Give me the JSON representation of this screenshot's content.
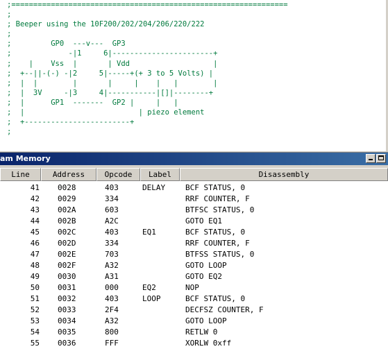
{
  "editor": {
    "lines": [
      ";===============================================================",
      ";",
      "; Beeper using the 10F200/202/204/206/220/222",
      ";",
      ";         GP0  ---v---  GP3",
      ";             -|1     6|-----------------------+",
      ";    |    Vss  |       | Vdd                   |",
      ";  +--||-(-) -|2     5|-----+(+ 3 to 5 Volts) |",
      ";  |  |        |       |     |    |   |        |",
      ";  |  3V     -|3     4|-----------|[]|--------+",
      ";  |      GP1  -------  GP2 |     |   |",
      ";  |                          | piezo element",
      ";  +------------------------+",
      ";"
    ]
  },
  "window": {
    "title": "am Memory",
    "minimize_glyph": "_",
    "maximize_glyph": "□"
  },
  "table": {
    "headers": {
      "line": "Line",
      "address": "Address",
      "opcode": "Opcode",
      "label": "Label",
      "disassembly": "Disassembly"
    },
    "rows": [
      {
        "line": "41",
        "address": "0028",
        "opcode": "403",
        "label": "DELAY",
        "disassembly": "BCF STATUS, 0"
      },
      {
        "line": "42",
        "address": "0029",
        "opcode": "334",
        "label": "",
        "disassembly": "RRF COUNTER, F"
      },
      {
        "line": "43",
        "address": "002A",
        "opcode": "603",
        "label": "",
        "disassembly": "BTFSC STATUS, 0"
      },
      {
        "line": "44",
        "address": "002B",
        "opcode": "A2C",
        "label": "",
        "disassembly": "GOTO EQ1"
      },
      {
        "line": "45",
        "address": "002C",
        "opcode": "403",
        "label": "EQ1",
        "disassembly": "BCF STATUS, 0"
      },
      {
        "line": "46",
        "address": "002D",
        "opcode": "334",
        "label": "",
        "disassembly": "RRF COUNTER, F"
      },
      {
        "line": "47",
        "address": "002E",
        "opcode": "703",
        "label": "",
        "disassembly": "BTFSS STATUS, 0"
      },
      {
        "line": "48",
        "address": "002F",
        "opcode": "A32",
        "label": "",
        "disassembly": "GOTO LOOP"
      },
      {
        "line": "49",
        "address": "0030",
        "opcode": "A31",
        "label": "",
        "disassembly": "GOTO EQ2"
      },
      {
        "line": "50",
        "address": "0031",
        "opcode": "000",
        "label": "EQ2",
        "disassembly": "NOP"
      },
      {
        "line": "51",
        "address": "0032",
        "opcode": "403",
        "label": "LOOP",
        "disassembly": "BCF STATUS, 0"
      },
      {
        "line": "52",
        "address": "0033",
        "opcode": "2F4",
        "label": "",
        "disassembly": "DECFSZ COUNTER, F"
      },
      {
        "line": "53",
        "address": "0034",
        "opcode": "A32",
        "label": "",
        "disassembly": "GOTO LOOP"
      },
      {
        "line": "54",
        "address": "0035",
        "opcode": "800",
        "label": "",
        "disassembly": "RETLW 0"
      },
      {
        "line": "55",
        "address": "0036",
        "opcode": "FFF",
        "label": "",
        "disassembly": "XORLW 0xff"
      }
    ]
  },
  "colors": {
    "code_text": "#007a3d",
    "title_bar_start": "#0a246a",
    "title_bar_end": "#3a6ea5"
  }
}
